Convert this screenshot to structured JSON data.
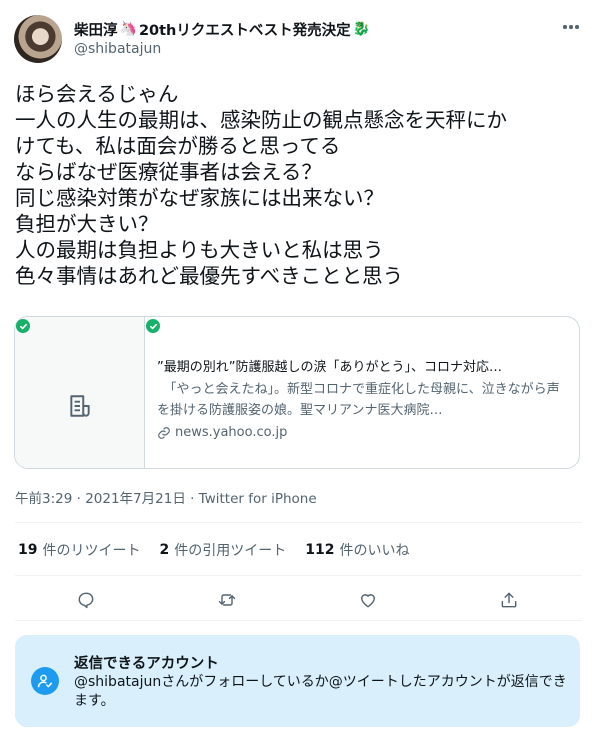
{
  "author": {
    "name": "柴田淳",
    "name_suffix": "20thリクエストベスト発売決定",
    "handle": "@shibatajun"
  },
  "tweet": {
    "lines": [
      "ほら会えるじゃん",
      "一人の人生の最期は、感染防止の観点懸念を天秤にか",
      "けても、私は面会が勝ると思ってる",
      "ならばなぜ医療従事者は会える？",
      "同じ感染対策がなぜ家族には出来ない？",
      "負担が大きい？",
      "人の最期は負担よりも大きいと私は思う",
      "色々事情はあれど最優先すべきことと思う"
    ],
    "meta": "午前3:29 · 2021年7月21日 · Twitter for iPhone"
  },
  "card": {
    "title": "”最期の別れ”防護服越しの涙「ありがとう」、コロナ対応…",
    "description": "　「やっと会えたね」。新型コロナで重症化した母親に、泣きながら声を掛ける防護服姿の娘。聖マリアンナ医大病院…",
    "domain": "news.yahoo.co.jp"
  },
  "stats": {
    "retweets_count": "19",
    "retweets_label": "件のリツイート",
    "quotes_count": "2",
    "quotes_label": "件の引用ツイート",
    "likes_count": "112",
    "likes_label": "件のいいね"
  },
  "reply_notice": {
    "title": "返信できるアカウント",
    "description": "@shibatajunさんがフォローしているか@ツイートしたアカウントが返信できます。"
  },
  "icons": {
    "more": "more-icon",
    "document": "document-icon",
    "link": "link-icon",
    "verified_check": "check-icon",
    "reply": "reply-icon",
    "retweet": "retweet-icon",
    "like": "like-icon",
    "share": "share-icon",
    "account": "account-icon"
  },
  "colors": {
    "accent": "#1d9bf0",
    "check": "#17b169",
    "reply_box": "#d9f0fc",
    "secondary_text": "#536471"
  }
}
